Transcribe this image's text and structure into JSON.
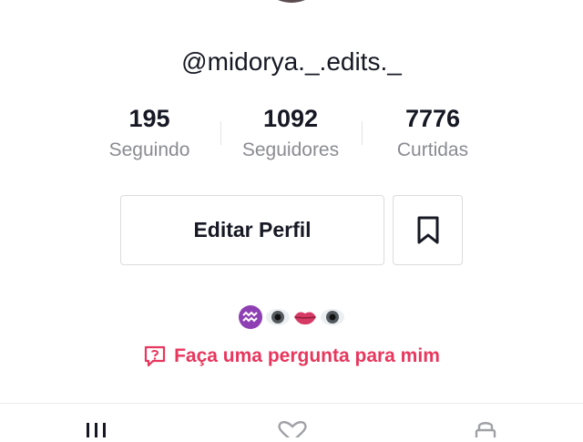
{
  "profile": {
    "username": "@midorya._.edits._"
  },
  "stats": {
    "following": {
      "value": "195",
      "label": "Seguindo"
    },
    "followers": {
      "value": "1092",
      "label": "Seguidores"
    },
    "likes": {
      "value": "7776",
      "label": "Curtidas"
    }
  },
  "actions": {
    "edit_profile_label": "Editar Perfil",
    "bookmark_icon": "bookmark-icon"
  },
  "bio": {
    "emojis": [
      "aquarius-icon",
      "eye-icon",
      "lips-icon",
      "eye-icon"
    ]
  },
  "ask_question": {
    "label": "Faça uma pergunta para mim",
    "icon": "question-bubble-icon"
  },
  "tabs": [
    {
      "icon": "grid-icon"
    },
    {
      "icon": "liked-heart-icon"
    },
    {
      "icon": "lock-icon"
    }
  ],
  "colors": {
    "accent": "#e8365d",
    "text": "#161823",
    "secondary_text": "#8a8b91",
    "border": "#dcdcde"
  }
}
